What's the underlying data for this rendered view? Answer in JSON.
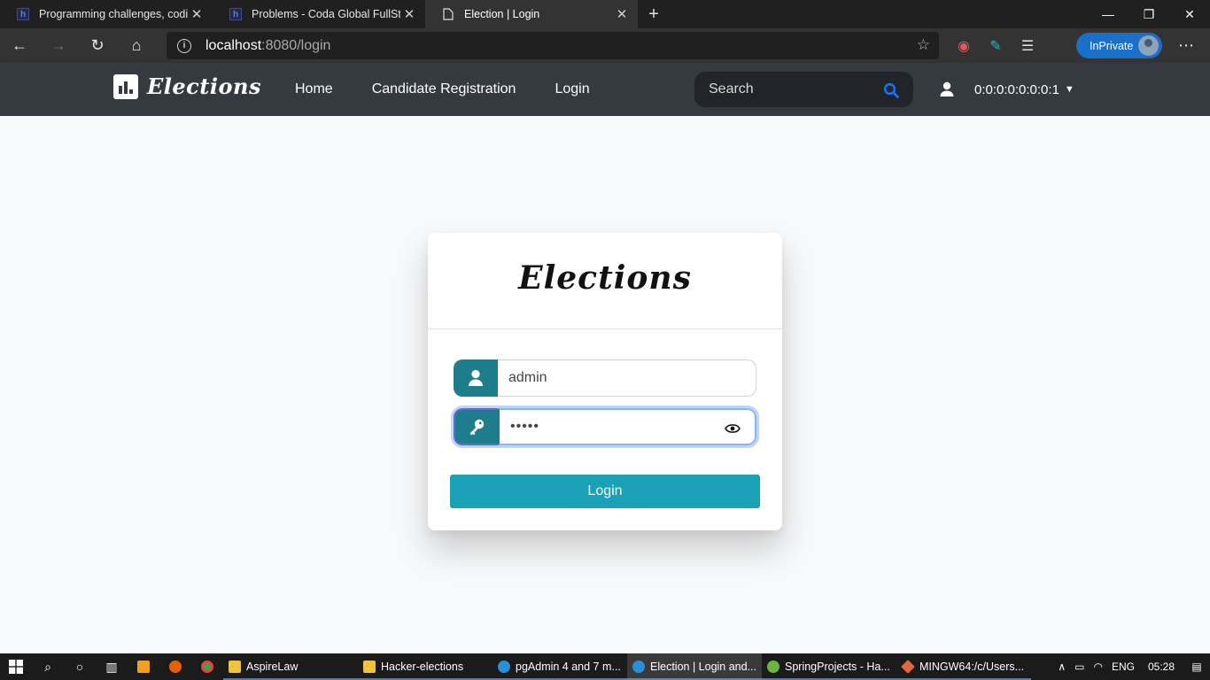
{
  "browser": {
    "tabs": [
      {
        "title": "Programming challenges, coding"
      },
      {
        "title": "Problems - Coda Global FullStack"
      },
      {
        "title": "Election | Login"
      }
    ],
    "url": {
      "host": "localhost",
      "path": ":8080/login"
    },
    "inprivate_label": "InPrivate"
  },
  "navbar": {
    "brand": "Elections",
    "links": [
      "Home",
      "Candidate Registration",
      "Login"
    ],
    "search_placeholder": "Search",
    "user_ip": "0:0:0:0:0:0:0:1"
  },
  "login_card": {
    "title": "Elections",
    "username_value": "admin",
    "password_mask": "•••••",
    "login_button": "Login"
  },
  "taskbar": {
    "apps": [
      {
        "label": "AspireLaw",
        "icon_color": "#f0c33c"
      },
      {
        "label": "Hacker-elections",
        "icon_color": "#f0c33c"
      },
      {
        "label": "pgAdmin 4 and 7 m...",
        "icon_color": "#2a8fd8"
      },
      {
        "label": "Election | Login and...",
        "icon_color": "#2a8fd8"
      },
      {
        "label": "SpringProjects - Ha...",
        "icon_color": "#6db33f"
      },
      {
        "label": "MINGW64:/c/Users...",
        "icon_color": "#e2673a"
      }
    ],
    "lang": "ENG",
    "time": "05:28"
  },
  "colors": {
    "navbar_bg": "#343a40",
    "input_icon_bg": "#1e7d8a",
    "login_button_bg": "#1aa1b7",
    "search_icon": "#1a73e8"
  }
}
